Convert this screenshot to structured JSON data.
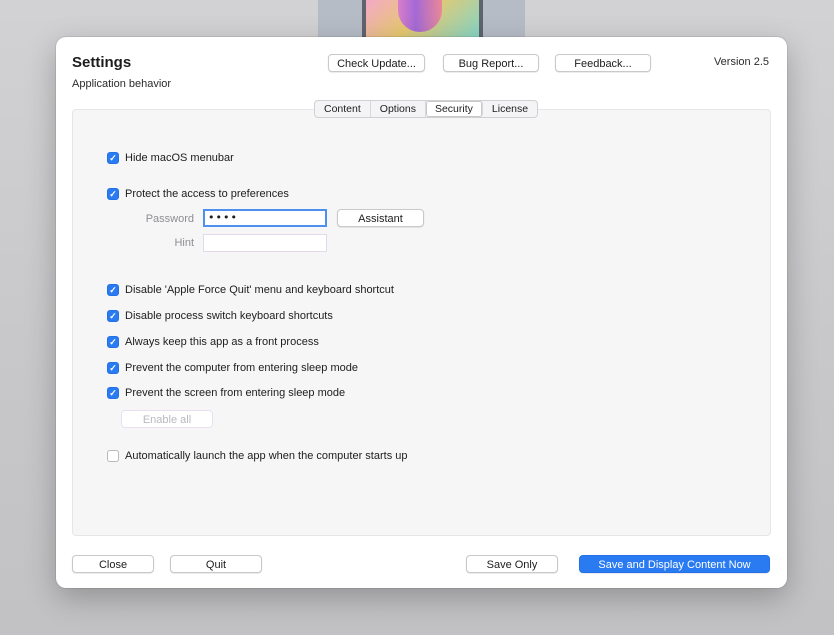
{
  "window": {
    "title": "Settings",
    "subtitle": "Application behavior",
    "version": "Version 2.5"
  },
  "header_buttons": {
    "check_update": "Check Update...",
    "bug_report": "Bug Report...",
    "feedback": "Feedback..."
  },
  "tabs": [
    {
      "label": "Content",
      "active": false
    },
    {
      "label": "Options",
      "active": false
    },
    {
      "label": "Security",
      "active": true
    },
    {
      "label": "License",
      "active": false
    }
  ],
  "security": {
    "hide_menubar": {
      "label": "Hide macOS menubar",
      "checked": true
    },
    "protect_prefs": {
      "label": "Protect the access to preferences",
      "checked": true
    },
    "password": {
      "label": "Password",
      "value": "••••"
    },
    "assistant_label": "Assistant",
    "hint": {
      "label": "Hint",
      "value": ""
    },
    "disable_force_quit": {
      "label": "Disable 'Apple Force Quit' menu and keyboard shortcut",
      "checked": true
    },
    "disable_process_switch": {
      "label": "Disable process switch keyboard shortcuts",
      "checked": true
    },
    "front_process": {
      "label": "Always keep this app as a front process",
      "checked": true
    },
    "prevent_sleep": {
      "label": "Prevent the computer from entering sleep mode",
      "checked": true
    },
    "prevent_screen_sleep": {
      "label": "Prevent the screen from entering sleep mode",
      "checked": true
    },
    "enable_all_label": "Enable all",
    "auto_launch": {
      "label": "Automatically launch the app when the computer starts up",
      "checked": false
    }
  },
  "footer": {
    "close": "Close",
    "quit": "Quit",
    "save_only": "Save Only",
    "save_display": "Save and Display Content Now"
  },
  "colors": {
    "accent": "#2a7bf2",
    "window_bg": "#ffffff",
    "panel_bg": "#f6f6f7"
  },
  "icons": {
    "checkmark": "checkmark-icon"
  }
}
